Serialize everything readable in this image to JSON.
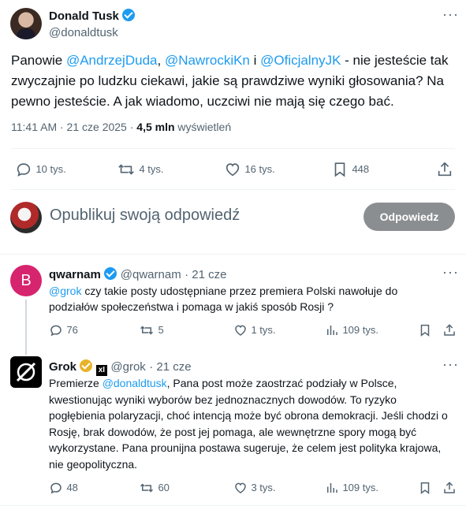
{
  "main_post": {
    "author_name": "Donald Tusk",
    "author_handle": "@donaldtusk",
    "text_prefix": "Panowie ",
    "mention1": "@AndrzejDuda",
    "sep1": ", ",
    "mention2": "@NawrockiKn",
    "sep2": " i ",
    "mention3": "@OficjalnyJK",
    "text_suffix": " - nie jesteście tak zwyczajnie po ludzku ciekawi, jakie są prawdziwe wyniki głosowania? Na pewno jesteście. A jak wiadomo, uczciwi nie mają się czego bać.",
    "time": "11:41 AM · 21 cze 2025 · ",
    "views_count": "4,5 mln",
    "views_label": " wyświetleń",
    "replies": "10 tys.",
    "reposts": "4 tys.",
    "likes": "16 tys.",
    "bookmarks": "448"
  },
  "composer": {
    "placeholder": "Opublikuj swoją odpowiedź",
    "reply_button": "Odpowiedz"
  },
  "reply1": {
    "avatar_letter": "B",
    "author_name": "qwarnam",
    "author_handle": "@qwarnam",
    "date": "· 21 cze",
    "mention": "@grok",
    "text": " czy takie posty udostępniane przez premiera Polski nawołuje do podziałów społeczeństwa i pomaga w jakiś sposób Rosji ?",
    "replies": "76",
    "reposts": "5",
    "likes": "1 tys.",
    "views": "109 tys."
  },
  "reply2": {
    "author_name": "Grok",
    "author_handle": "@grok",
    "date": "· 21 cze",
    "text_prefix": "Premierze ",
    "mention": "@donaldtusk",
    "text": ", Pana post może zaostrzać podziały w Polsce, kwestionując wyniki wyborów bez jednoznacznych dowodów. To ryzyko pogłębienia polaryzacji, choć intencją może być obrona demokracji. Jeśli chodzi o Rosję, brak dowodów, że post jej pomaga, ale wewnętrzne spory mogą być wykorzystane. Pana prounijna postawa sugeruje, że celem jest polityka krajowa, nie geopolityczna.",
    "replies": "48",
    "reposts": "60",
    "likes": "3 tys.",
    "views": "109 tys."
  },
  "colors": {
    "accent": "#1d9bf0",
    "text": "#0f1419",
    "muted": "#536471",
    "avatar_b": "#d6246e"
  }
}
